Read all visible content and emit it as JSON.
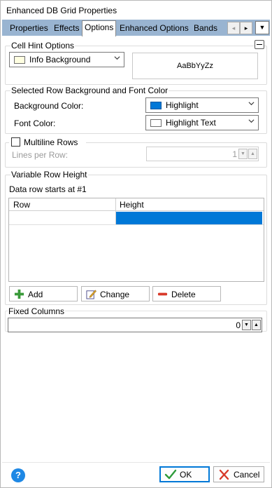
{
  "window": {
    "title": "Enhanced DB Grid Properties"
  },
  "tabs": [
    {
      "label": "Properties"
    },
    {
      "label": "Effects"
    },
    {
      "label": "Options"
    },
    {
      "label": "Enhanced Options"
    },
    {
      "label": "Bands"
    }
  ],
  "tab_scroll": {
    "left": "◂",
    "right": "▸",
    "menu": "▼"
  },
  "cell_hint": {
    "title": "Cell Hint Options",
    "color_value": "Info Background",
    "color_swatch": "#ffffe1",
    "preview_text": "AaBbYyZz"
  },
  "selected_row": {
    "title": "Selected Row Background and Font Color",
    "bg_label": "Background Color:",
    "bg_value": "Highlight",
    "bg_swatch": "#0078d7",
    "font_label": "Font Color:",
    "font_value": "Highlight Text",
    "font_swatch": "#ffffff"
  },
  "multiline": {
    "checkbox_label": "Multiline Rows",
    "lines_label": "Lines per Row:",
    "lines_value": "1"
  },
  "variable_row": {
    "title": "Variable Row Height",
    "info": "Data row starts at #1",
    "columns": [
      "Row",
      "Height"
    ],
    "add_label": "Add",
    "change_label": "Change",
    "delete_label": "Delete"
  },
  "fixed_columns": {
    "title": "Fixed Columns",
    "value": "0"
  },
  "footer": {
    "help": "?",
    "ok_label": "OK",
    "cancel_label": "Cancel"
  },
  "colors": {
    "accent": "#0078d7",
    "tabstrip": "#99b4d1"
  }
}
